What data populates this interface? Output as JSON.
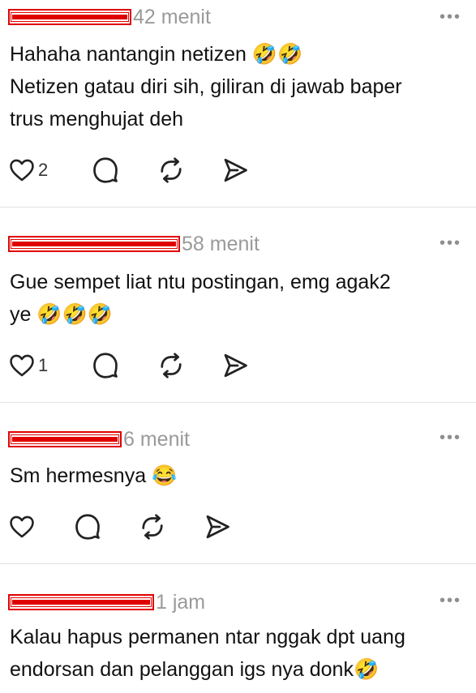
{
  "posts": [
    {
      "time": "42 menit",
      "text": "Hahaha nantangin netizen 🤣🤣\nNetizen gatau diri sih, giliran di jawab baper\ntrus menghujat deh",
      "likes": "2"
    },
    {
      "time": "58 menit",
      "text": "Gue sempet liat ntu postingan, emg agak2\nye 🤣🤣🤣",
      "likes": "1"
    },
    {
      "time": "6 menit",
      "text": "Sm hermesnya 😂",
      "likes": ""
    },
    {
      "time": "1 jam",
      "text": "Kalau hapus permanen ntar nggak dpt uang\nendorsan dan pelanggan igs nya donk🤣",
      "likes": ""
    }
  ],
  "more_label": "•••",
  "icons": [
    "heart-icon",
    "comment-icon",
    "repost-icon",
    "share-icon",
    "more-icon"
  ],
  "colors": {
    "redaction": "#e00000",
    "timestamp": "#9a9a9a",
    "divider": "#e2e2e2"
  }
}
